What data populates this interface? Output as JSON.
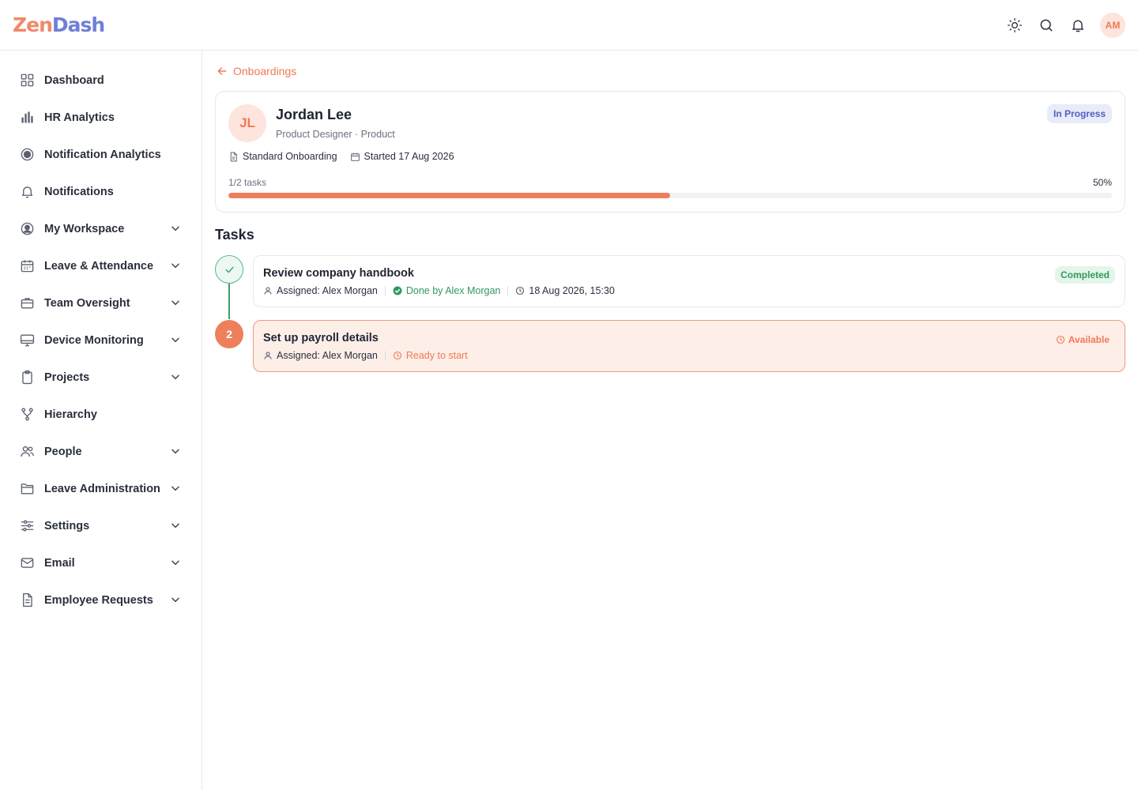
{
  "app": {
    "logo_part1": "Zen",
    "logo_part2": "Dash",
    "user_initials": "AM"
  },
  "topbar": {
    "icons": [
      "sun-icon",
      "search-icon",
      "bell-icon"
    ]
  },
  "sidebar": {
    "items": [
      {
        "label": "Dashboard",
        "icon": "grid-icon",
        "expandable": false
      },
      {
        "label": "HR Analytics",
        "icon": "bar-chart-icon",
        "expandable": false
      },
      {
        "label": "Notification Analytics",
        "icon": "target-icon",
        "expandable": false
      },
      {
        "label": "Notifications",
        "icon": "bell-icon",
        "expandable": false
      },
      {
        "label": "My Workspace",
        "icon": "user-circle-icon",
        "expandable": true
      },
      {
        "label": "Leave & Attendance",
        "icon": "calendar-icon",
        "expandable": true
      },
      {
        "label": "Team Oversight",
        "icon": "briefcase-icon",
        "expandable": true
      },
      {
        "label": "Device Monitoring",
        "icon": "monitor-icon",
        "expandable": true
      },
      {
        "label": "Projects",
        "icon": "clipboard-icon",
        "expandable": true
      },
      {
        "label": "Hierarchy",
        "icon": "hierarchy-icon",
        "expandable": false
      },
      {
        "label": "People",
        "icon": "people-icon",
        "expandable": true
      },
      {
        "label": "Leave Administration",
        "icon": "folder-icon",
        "expandable": true
      },
      {
        "label": "Settings",
        "icon": "sliders-icon",
        "expandable": true
      },
      {
        "label": "Email",
        "icon": "mail-icon",
        "expandable": true
      },
      {
        "label": "Employee Requests",
        "icon": "document-icon",
        "expandable": true
      }
    ]
  },
  "main": {
    "back_label": "Onboardings",
    "employee": {
      "initials": "JL",
      "name": "Jordan Lee",
      "role": "Product Designer · Product",
      "status": "In Progress",
      "template": "Standard Onboarding",
      "started": "Started 17 Aug 2026",
      "progress_label": "1/2 tasks",
      "progress_pct_label": "50%",
      "progress_fraction": 0.5
    },
    "tasks_title": "Tasks",
    "tasks": [
      {
        "step": "1",
        "title": "Review company handbook",
        "assigned": "Assigned: Alex Morgan",
        "done_by": "Done by Alex Morgan",
        "timestamp": "18 Aug 2026, 15:30",
        "status": "Completed"
      },
      {
        "step": "2",
        "title": "Set up payroll details",
        "assigned": "Assigned: Alex Morgan",
        "state": "Ready to start",
        "status": "Available"
      }
    ]
  },
  "colors": {
    "accent": "#ee7f5b",
    "success": "#2f9a5e",
    "info": "#4f5fc0"
  }
}
